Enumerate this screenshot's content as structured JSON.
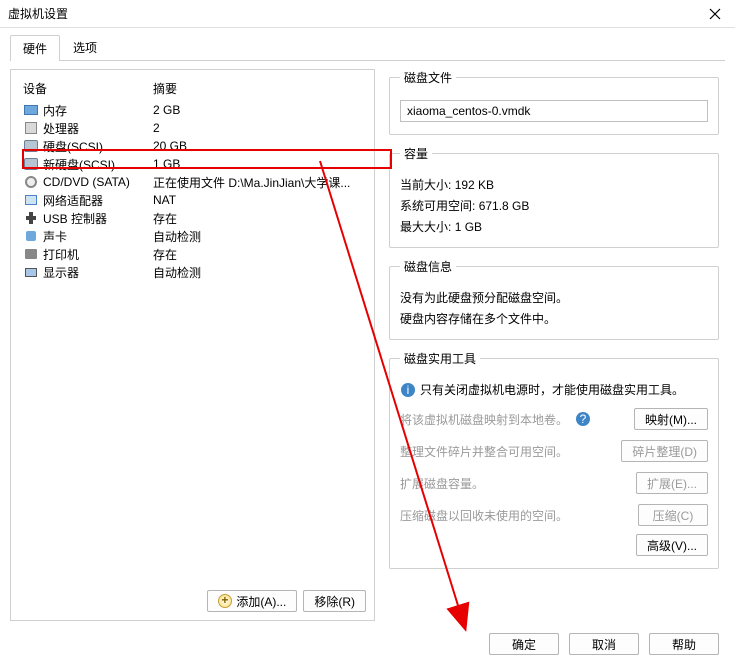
{
  "window": {
    "title": "虚拟机设置"
  },
  "tabs": {
    "hardware": "硬件",
    "options": "选项"
  },
  "columns": {
    "device": "设备",
    "summary": "摘要"
  },
  "devices": [
    {
      "name": "内存",
      "summary": "2 GB",
      "icon": "chip-icon"
    },
    {
      "name": "处理器",
      "summary": "2",
      "icon": "cpu-icon"
    },
    {
      "name": "硬盘(SCSI)",
      "summary": "20 GB",
      "icon": "disk-icon"
    },
    {
      "name": "新硬盘(SCSI)",
      "summary": "1 GB",
      "icon": "disk-icon"
    },
    {
      "name": "CD/DVD (SATA)",
      "summary": "正在使用文件 D:\\Ma.JinJian\\大学课...",
      "icon": "cd-icon"
    },
    {
      "name": "网络适配器",
      "summary": "NAT",
      "icon": "net-icon"
    },
    {
      "name": "USB 控制器",
      "summary": "存在",
      "icon": "usb-icon"
    },
    {
      "name": "声卡",
      "summary": "自动检测",
      "icon": "sound-icon"
    },
    {
      "name": "打印机",
      "summary": "存在",
      "icon": "printer-icon"
    },
    {
      "name": "显示器",
      "summary": "自动检测",
      "icon": "monitor-icon"
    }
  ],
  "selected_index": 3,
  "buttons": {
    "add": "添加(A)...",
    "remove": "移除(R)"
  },
  "panel": {
    "disk_file": {
      "legend": "磁盘文件",
      "value": "xiaoma_centos-0.vmdk"
    },
    "capacity": {
      "legend": "容量",
      "current_size_label": "当前大小:",
      "current_size_value": "192 KB",
      "free_space_label": "系统可用空间:",
      "free_space_value": "671.8 GB",
      "max_size_label": "最大大小:",
      "max_size_value": "1 GB"
    },
    "disk_info": {
      "legend": "磁盘信息",
      "line1": "没有为此硬盘预分配磁盘空间。",
      "line2": "硬盘内容存储在多个文件中。"
    },
    "tools": {
      "legend": "磁盘实用工具",
      "notice": "只有关闭虚拟机电源时，才能使用磁盘实用工具。",
      "map_desc": "将该虚拟机磁盘映射到本地卷。",
      "map_btn": "映射(M)...",
      "defrag_desc": "整理文件碎片并整合可用空间。",
      "defrag_btn": "碎片整理(D)",
      "expand_desc": "扩展磁盘容量。",
      "expand_btn": "扩展(E)...",
      "compact_desc": "压缩磁盘以回收未使用的空间。",
      "compact_btn": "压缩(C)",
      "advanced_btn": "高级(V)..."
    }
  },
  "footer": {
    "ok": "确定",
    "cancel": "取消",
    "help": "帮助"
  }
}
